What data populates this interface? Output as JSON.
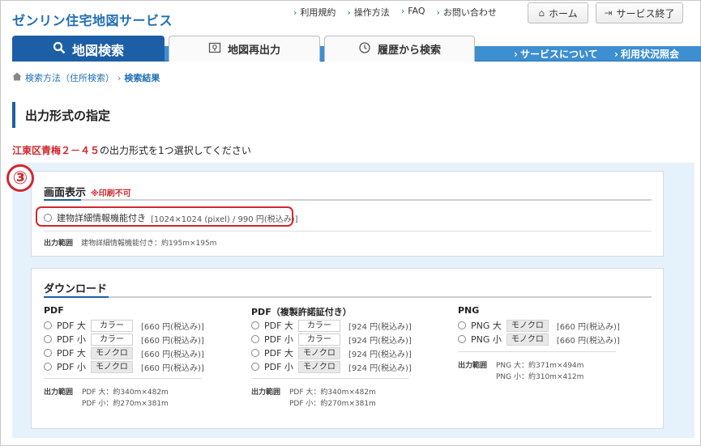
{
  "header": {
    "logo": "ゼンリン住宅地図サービス",
    "links": [
      "利用規約",
      "操作方法",
      "FAQ",
      "お問い合わせ"
    ],
    "home_label": "ホーム",
    "end_label": "サービス終了"
  },
  "nav": {
    "tabs": [
      "地図検索",
      "地図再出力",
      "履歴から検索"
    ],
    "right_links": [
      "サービスについて",
      "利用状況照会"
    ]
  },
  "breadcrumb": {
    "items": [
      "検索方法（住所検索）",
      "検索結果"
    ]
  },
  "page_title": "出力形式の指定",
  "instruction": {
    "address": "江東区青梅２－４５",
    "text": "の出力形式を1つ選択してください"
  },
  "step_marker": "③",
  "screen_display": {
    "title": "画面表示",
    "note": "※印刷不可",
    "option_label": "建物詳細情報機能付き",
    "option_price": "[1024×1024 (pixel) / 990 円(税込み)]",
    "range_label": "出力範囲",
    "range_value": "建物詳細情報機能付き：約195m×195m"
  },
  "download": {
    "title": "ダウンロード",
    "pdf": {
      "heading": "PDF",
      "rows": [
        {
          "label": "PDF 大",
          "badge": "カラー",
          "price": "[660 円(税込み)]"
        },
        {
          "label": "PDF 小",
          "badge": "カラー",
          "price": "[660 円(税込み)]"
        },
        {
          "label": "PDF 大",
          "badge": "モノクロ",
          "price": "[660 円(税込み)]"
        },
        {
          "label": "PDF 小",
          "badge": "モノクロ",
          "price": "[660 円(税込み)]"
        }
      ],
      "range_label": "出力範囲",
      "range_lines": [
        "PDF 大：約340m×482m",
        "PDF 小：約270m×381m"
      ]
    },
    "pdf_cert": {
      "heading": "PDF（複製許諾証付き）",
      "rows": [
        {
          "label": "PDF 大",
          "badge": "カラー",
          "price": "[924 円(税込み)]"
        },
        {
          "label": "PDF 小",
          "badge": "カラー",
          "price": "[924 円(税込み)]"
        },
        {
          "label": "PDF 大",
          "badge": "モノクロ",
          "price": "[924 円(税込み)]"
        },
        {
          "label": "PDF 小",
          "badge": "モノクロ",
          "price": "[924 円(税込み)]"
        }
      ],
      "range_label": "出力範囲",
      "range_lines": [
        "PDF 大：約340m×482m",
        "PDF 小：約270m×381m"
      ]
    },
    "png": {
      "heading": "PNG",
      "rows": [
        {
          "label": "PNG 大",
          "badge": "モノクロ",
          "price": "[660 円(税込み)]"
        },
        {
          "label": "PNG 小",
          "badge": "モノクロ",
          "price": "[660 円(税込み)]"
        }
      ],
      "range_label": "出力範囲",
      "range_lines": [
        "PNG 大：約371m×494m",
        "PNG 小：約310m×412m"
      ]
    }
  }
}
